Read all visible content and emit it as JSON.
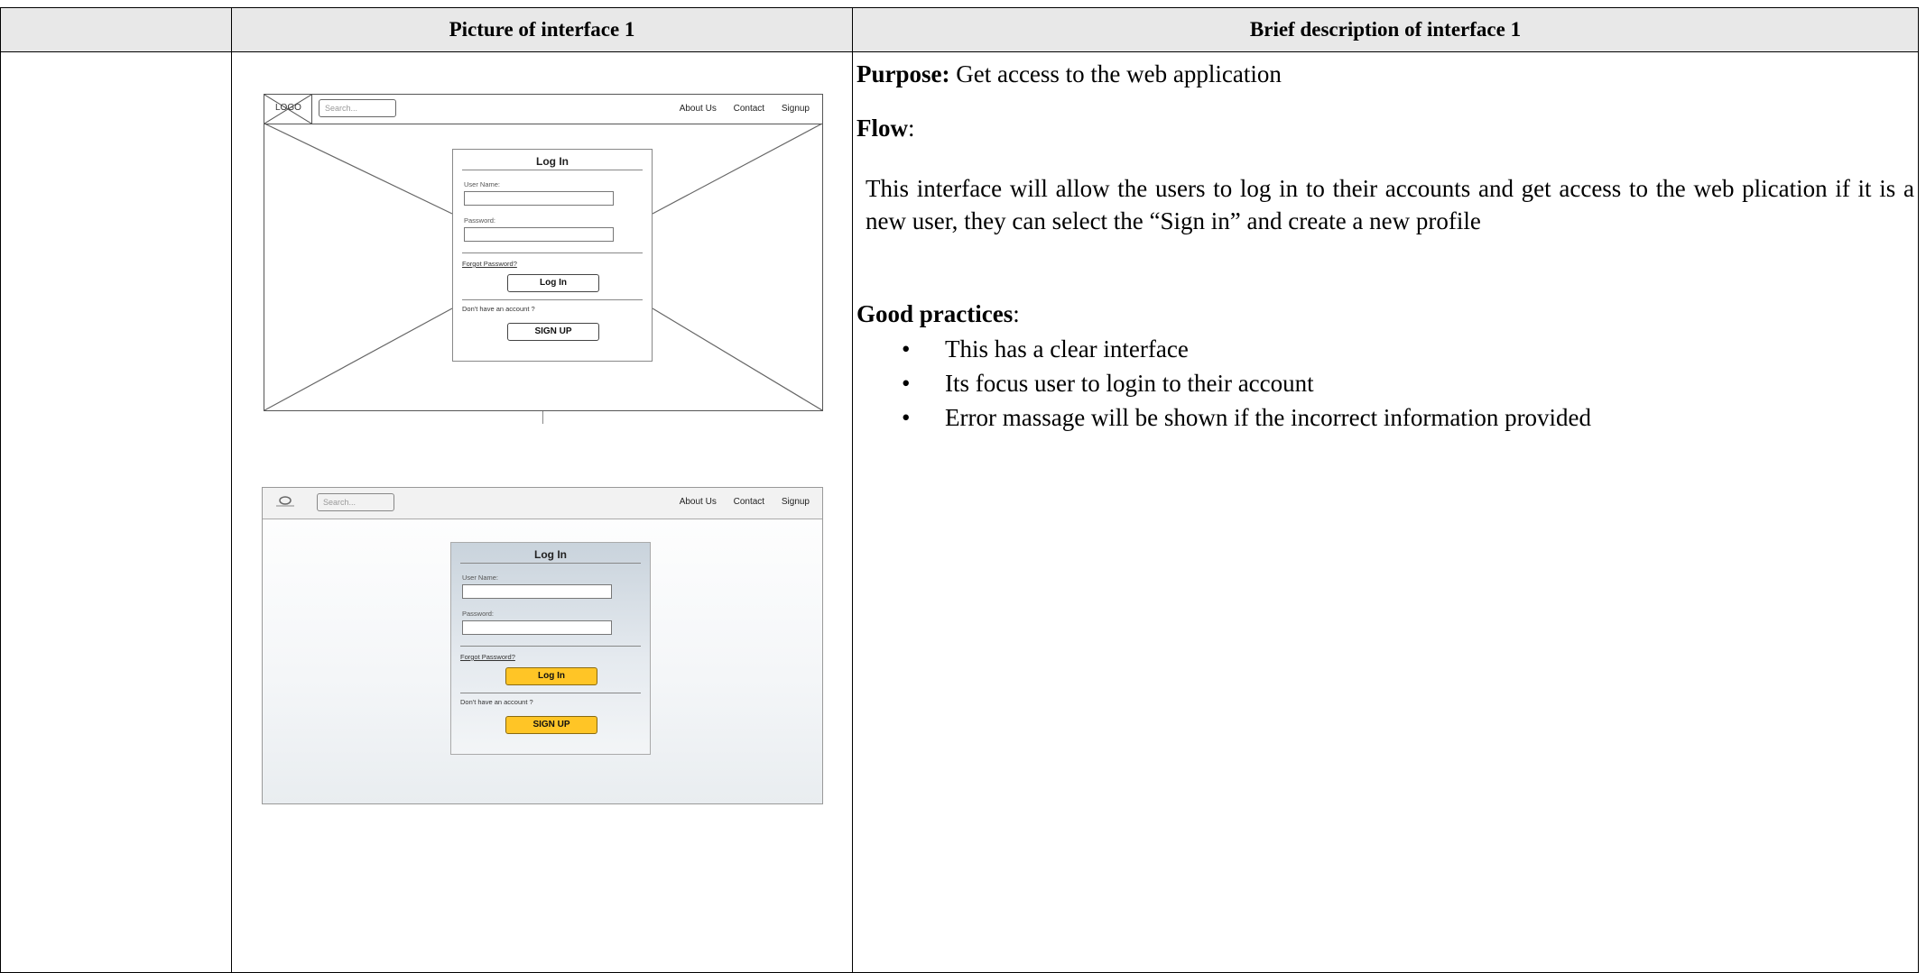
{
  "table": {
    "header_col2": "Picture of interface 1",
    "header_col3": "Brief description of interface 1"
  },
  "description": {
    "purpose_label": "Purpose:",
    "purpose_text": " Get access to the web application",
    "flow_label": "Flow",
    "flow_colon": ":",
    "flow_text": "This interface will allow the users to log in to their accounts and get access to the web plication if it is a new user, they can select the “Sign in” and create a new profile",
    "good_label": "Good practices",
    "good_colon": ":",
    "good_practices": [
      "This has a clear interface",
      "Its focus user to login to their account",
      "Error massage will be shown if the incorrect information provided"
    ]
  },
  "wireframe": {
    "logo": "LOGO",
    "search_placeholder": "Search...",
    "nav": [
      "About Us",
      "Contact",
      "Signup"
    ],
    "login_title": "Log In",
    "username_label": "User Name:",
    "password_label": "Password:",
    "forgot_link": "Forgot Password?",
    "login_button": "Log In",
    "no_account_text": "Don't have an account ?",
    "signup_button": "SIGN UP"
  },
  "mockup": {
    "search_placeholder": "Search...",
    "nav": [
      "About Us",
      "Contact",
      "Signup"
    ],
    "login_title": "Log In",
    "username_label": "User Name:",
    "password_label": "Password:",
    "forgot_link": "Forgot Password?",
    "login_button": "Log In",
    "no_account_text": "Don't have an account ?",
    "signup_button": "SIGN UP",
    "button_color": "#ffc526"
  }
}
